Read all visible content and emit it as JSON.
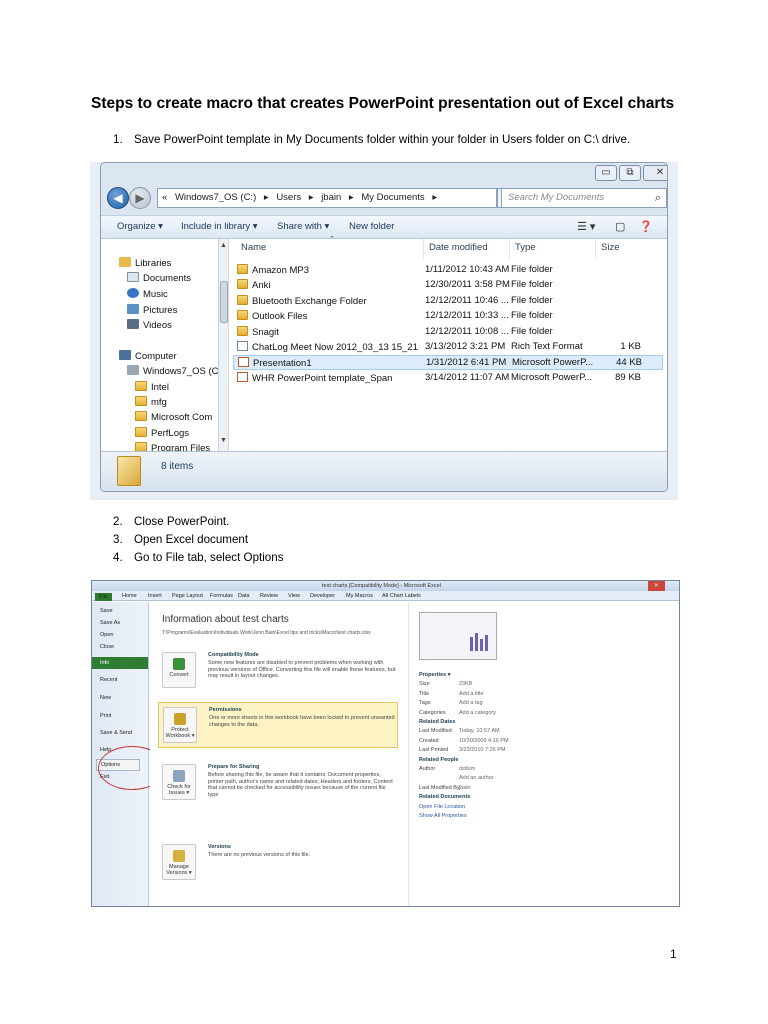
{
  "doc_title": "Steps to create macro that creates PowerPoint presentation out of Excel charts",
  "steps": [
    {
      "num": "1.",
      "text": "Save PowerPoint template in My Documents folder within your folder in Users folder on C:\\ drive."
    },
    {
      "num": "2.",
      "text": "Close PowerPoint."
    },
    {
      "num": "3.",
      "text": "Open Excel document"
    },
    {
      "num": "4.",
      "text": "Go to File tab, select Options"
    }
  ],
  "page_number": "1",
  "explorer": {
    "breadcrumb": [
      "«",
      "Windows7_OS (C:)",
      "▸",
      "Users",
      "▸",
      "jbain",
      "▸",
      "My Documents",
      "▸"
    ],
    "search_placeholder": "Search My Documents",
    "toolbar": {
      "organize": "Organize ▾",
      "include": "Include in library ▾",
      "share": "Share with ▾",
      "new_folder": "New folder"
    },
    "nav": {
      "libraries": "Libraries",
      "documents": "Documents",
      "music": "Music",
      "pictures": "Pictures",
      "videos": "Videos",
      "computer": "Computer",
      "drive": "Windows7_OS (C",
      "folders": [
        "Intel",
        "mfg",
        "Microsoft Com",
        "PerfLogs",
        "Program Files"
      ]
    },
    "columns": {
      "name": "Name",
      "date": "Date modified",
      "type": "Type",
      "size": "Size"
    },
    "files": [
      {
        "name": "Amazon MP3",
        "date": "1/11/2012 10:43 AM",
        "type": "File folder",
        "size": "",
        "icon": "folder"
      },
      {
        "name": "Anki",
        "date": "12/30/2011 3:58 PM",
        "type": "File folder",
        "size": "",
        "icon": "folder"
      },
      {
        "name": "Bluetooth Exchange Folder",
        "date": "12/12/2011 10:46 ...",
        "type": "File folder",
        "size": "",
        "icon": "folder"
      },
      {
        "name": "Outlook Files",
        "date": "12/12/2011 10:33 ...",
        "type": "File folder",
        "size": "",
        "icon": "folder"
      },
      {
        "name": "Snagit",
        "date": "12/12/2011 10:08 ...",
        "type": "File folder",
        "size": "",
        "icon": "folder"
      },
      {
        "name": "ChatLog Meet Now 2012_03_13 15_21",
        "date": "3/13/2012 3:21 PM",
        "type": "Rich Text Format",
        "size": "1 KB",
        "icon": "doc"
      },
      {
        "name": "Presentation1",
        "date": "1/31/2012 6:41 PM",
        "type": "Microsoft PowerP...",
        "size": "44 KB",
        "icon": "ppt"
      },
      {
        "name": "WHR PowerPoint template_Span",
        "date": "3/14/2012 11:07 AM",
        "type": "Microsoft PowerP...",
        "size": "89 KB",
        "icon": "ppt"
      }
    ],
    "selected_row": 6,
    "item_count": "8 items"
  },
  "excel": {
    "window_title": "test charts [Compatibility Mode] - Microsoft Excel",
    "file_tab": "File",
    "tabs": [
      "Home",
      "Insert",
      "Page Layout",
      "Formulas",
      "Data",
      "Review",
      "View",
      "Developer",
      "My Macros",
      "All Chart Labels"
    ],
    "left_menu": [
      "Save",
      "Save As",
      "Open",
      "Close",
      "Info",
      "Recent",
      "New",
      "Print",
      "Save & Send",
      "Help",
      "Options",
      "Exit"
    ],
    "info_title": "Information about test charts",
    "path": "T:\\Programs\\Evaluation\\Individuals Work\\Jenn Bain\\Excel tips and tricks\\Macro\\test charts.xlsx",
    "sections": [
      {
        "button": "Convert",
        "head": "Compatibility Mode",
        "body": "Some new features are disabled to prevent problems when working with previous versions of Office. Converting this file will enable these features, but may result in layout changes."
      },
      {
        "button": "Protect Workbook ▾",
        "head": "Permissions",
        "body": "One or more sheets in this workbook have been locked to prevent unwanted changes to the data."
      },
      {
        "button": "Check for Issues ▾",
        "head": "Prepare for Sharing",
        "body": "Before sharing this file, be aware that it contains: Document properties, printer path, author's name and related dates; Headers and footers; Content that cannot be checked for accessibility issues because of the current file type"
      },
      {
        "button": "Manage Versions ▾",
        "head": "Versions",
        "body": "There are no previous versions of this file."
      }
    ],
    "properties": [
      {
        "k": "Properties ▾",
        "v": ""
      },
      {
        "k": "Size",
        "v": "23KB"
      },
      {
        "k": "Title",
        "v": "Add a title"
      },
      {
        "k": "Tags",
        "v": "Add a tag"
      },
      {
        "k": "Categories",
        "v": "Add a category"
      },
      {
        "k": "Related Dates",
        "v": ""
      },
      {
        "k": "Last Modified",
        "v": "Today, 10:57 AM"
      },
      {
        "k": "Created",
        "v": "10/30/2009 4:16 PM"
      },
      {
        "k": "Last Printed",
        "v": "3/23/2010 7:26 PM"
      },
      {
        "k": "Related People",
        "v": ""
      },
      {
        "k": "Author",
        "v": "dstlum"
      },
      {
        "k": "",
        "v": "Add an author"
      },
      {
        "k": "Last Modified By",
        "v": "jbain"
      },
      {
        "k": "Related Documents",
        "v": ""
      },
      {
        "k": "Open File Location",
        "v": ""
      },
      {
        "k": "Show All Properties",
        "v": ""
      }
    ]
  }
}
